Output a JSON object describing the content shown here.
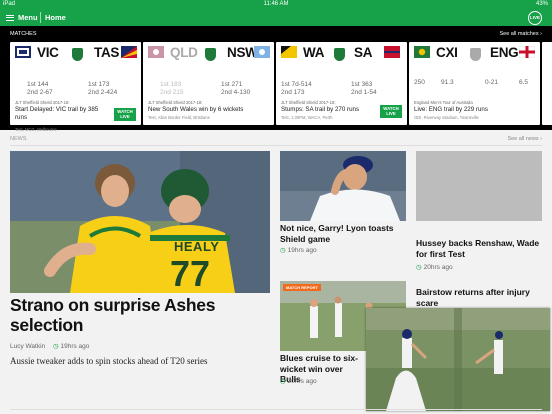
{
  "status_bar": {
    "device": "iPad",
    "time": "11:46 AM",
    "battery": "43%"
  },
  "nav": {
    "menu_label": "Menu",
    "home_label": "Home",
    "live_label": "LIVE"
  },
  "matches": {
    "heading": "MATCHES",
    "see_all": "See all matches",
    "cards": [
      {
        "team1": "VIC",
        "team2": "TAS",
        "team1_score1": "1st 144",
        "team1_score2": "2nd 2-67",
        "team2_score1": "1st 173",
        "team2_score2": "2nd 2-424",
        "competition": "JLT Sheffield Shield 2017-18:",
        "status": "Start Delayed: VIC trail by 385 runs",
        "venue": "Test, MCG, Melbourne",
        "watch_label": "WATCH LIVE"
      },
      {
        "team1": "QLD",
        "team2": "NSW",
        "team1_score1": "1st 183",
        "team1_score2": "2nd 215",
        "team2_score1": "1st 271",
        "team2_score2": "2nd 4-130",
        "competition": "JLT Sheffield Shield 2017-18:",
        "status": "New South Wales win by 6 wickets",
        "venue": "Test, Allan Border Field, Brisbane"
      },
      {
        "team1": "WA",
        "team2": "SA",
        "team1_score1": "1st 7d-514",
        "team1_score2": "2nd 173",
        "team2_score1": "1st 363",
        "team2_score2": "2nd 1-54",
        "competition": "JLT Sheffield Shield 2017-18:",
        "status": "Stumps: SA trail by 270 runs",
        "venue": "Test, 1:30PM, WACA, Perth",
        "watch_label": "WATCH LIVE"
      },
      {
        "team1": "CXI",
        "team2": "ENG",
        "team1_score1": "250",
        "team1_score2": "91.3",
        "team2_score1": "0-21",
        "team2_score2": "6.5",
        "competition": "England Men's Tour of Australia",
        "status": "Live: ENG trail by 229 runs",
        "venue": "ODI, Riverway Stadium, Townsville"
      }
    ]
  },
  "news": {
    "heading": "NEWS",
    "see_all": "See all news",
    "hero": {
      "title": "Strano on surprise Ashes selection",
      "author": "Lucy Watkin",
      "time": "19hrs ago",
      "description": "Aussie tweaker adds to spin stocks ahead of T20 series",
      "jersey_name": "HEALY",
      "jersey_number": "77"
    },
    "articles": [
      {
        "title": "Not nice, Garry! Lyon toasts Shield game",
        "time": "19hrs ago"
      },
      {
        "title": "Hussey backs Renshaw, Wade for first Test",
        "time": "20hrs ago"
      },
      {
        "title": "Blues cruise to six-wicket win over Bulls",
        "time": "20hrs ago",
        "tag": "MATCH REPORT"
      },
      {
        "title": "Bairstow returns after injury scare",
        "time": ""
      }
    ]
  }
}
